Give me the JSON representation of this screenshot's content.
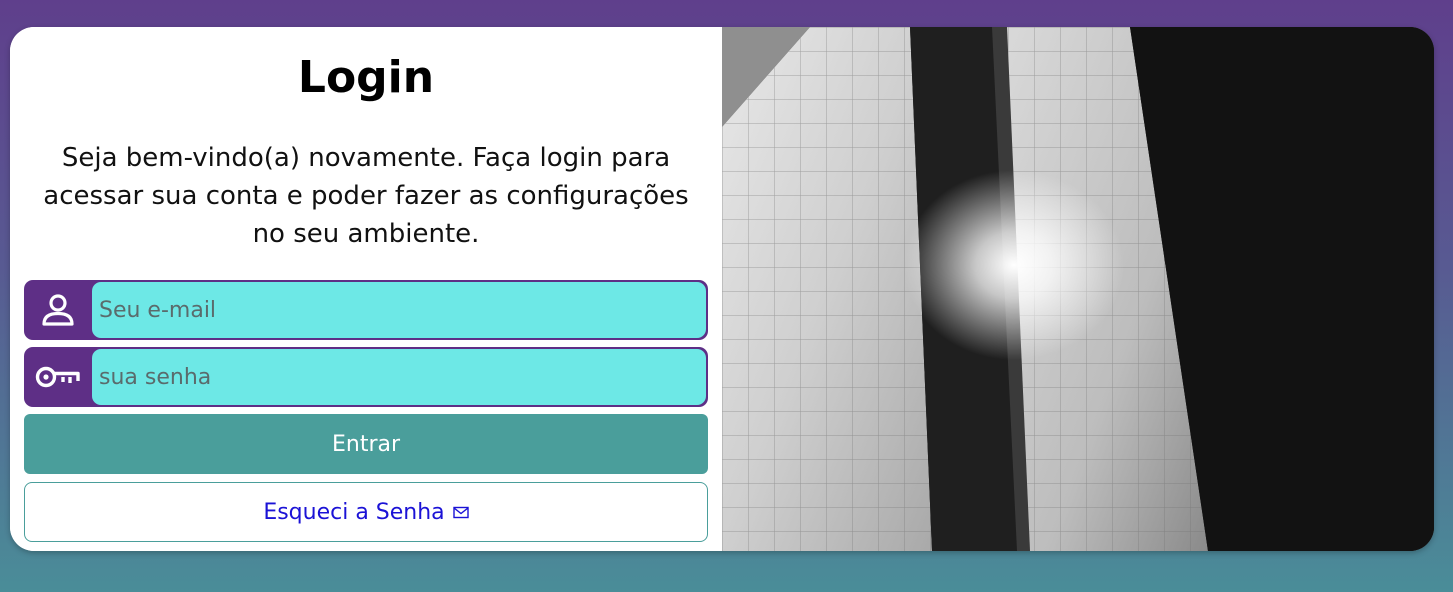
{
  "login": {
    "title": "Login",
    "subtitle": "Seja bem-vindo(a) novamente. Faça login para acessar sua conta e poder fazer as configurações no seu ambiente.",
    "email_placeholder": "Seu e-mail",
    "password_placeholder": "sua senha",
    "submit_label": "Entrar",
    "forgot_label": "Esqueci a Senha",
    "icons": {
      "email": "user-icon",
      "password": "key-icon",
      "forgot": "envelope-icon"
    }
  },
  "colors": {
    "field_icon_bg": "#5e2f86",
    "input_bg": "#6de8e6",
    "primary_button": "#4a9e9b",
    "link_text": "#1b12d6"
  }
}
